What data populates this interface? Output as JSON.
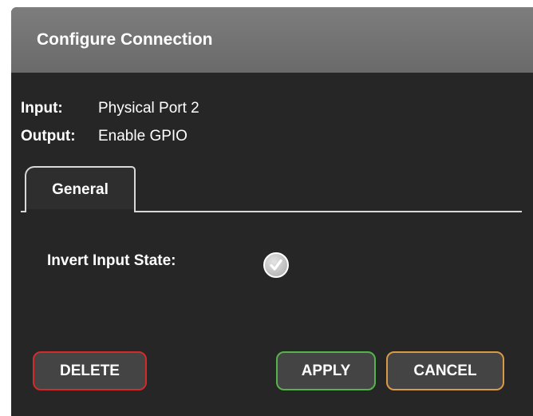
{
  "dialog": {
    "title": "Configure Connection",
    "input_label": "Input:",
    "input_value": "Physical Port 2",
    "output_label": "Output:",
    "output_value": "Enable GPIO"
  },
  "tabs": [
    {
      "label": "General",
      "active": true
    }
  ],
  "options": {
    "invert_input_state_label": "Invert Input State:",
    "invert_input_state_checked": true,
    "checkbox_icon": "check-icon"
  },
  "buttons": {
    "delete_label": "DELETE",
    "apply_label": "APPLY",
    "cancel_label": "CANCEL"
  },
  "colors": {
    "dialog_background": "#262626",
    "titlebar": "#737373",
    "delete_border": "#d12b2b",
    "apply_border": "#56b34a",
    "cancel_border": "#d99a45"
  }
}
